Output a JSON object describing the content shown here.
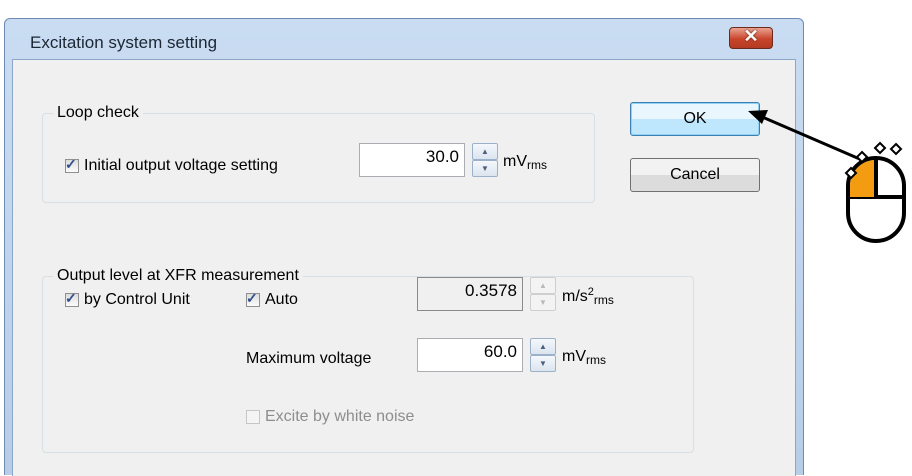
{
  "window": {
    "title": "Excitation system setting",
    "close_symbol": "✕"
  },
  "loop_check": {
    "legend": "Loop check",
    "initial_output": {
      "label": "Initial output voltage setting",
      "checked": true,
      "value": "30.0",
      "unit": "mV",
      "unit_sub": "rms"
    }
  },
  "output_level": {
    "legend": "Output level at XFR measurement",
    "by_control_unit": {
      "label": "by Control Unit",
      "checked": true
    },
    "auto": {
      "label": "Auto",
      "checked": true,
      "value": "0.3578",
      "unit": "m/s",
      "unit_sup": "2",
      "unit_sub": "rms"
    },
    "max_voltage": {
      "label": "Maximum voltage",
      "value": "60.0",
      "unit": "mV",
      "unit_sub": "rms"
    },
    "white_noise": {
      "label": "Excite by white noise",
      "checked": false,
      "enabled": false
    }
  },
  "buttons": {
    "ok": "OK",
    "cancel": "Cancel"
  },
  "symbols": {
    "check": "✓",
    "spin_up": "▲",
    "spin_down": "▼"
  },
  "icons": {
    "cursor": "arrow-pointer-icon",
    "mouse": "mouse-click-icon"
  },
  "colors": {
    "title_bar": "#c9dcf2",
    "close_button": "#c8452b",
    "default_button": "#3c7fb1",
    "mouse_highlight": "#f39c12"
  }
}
